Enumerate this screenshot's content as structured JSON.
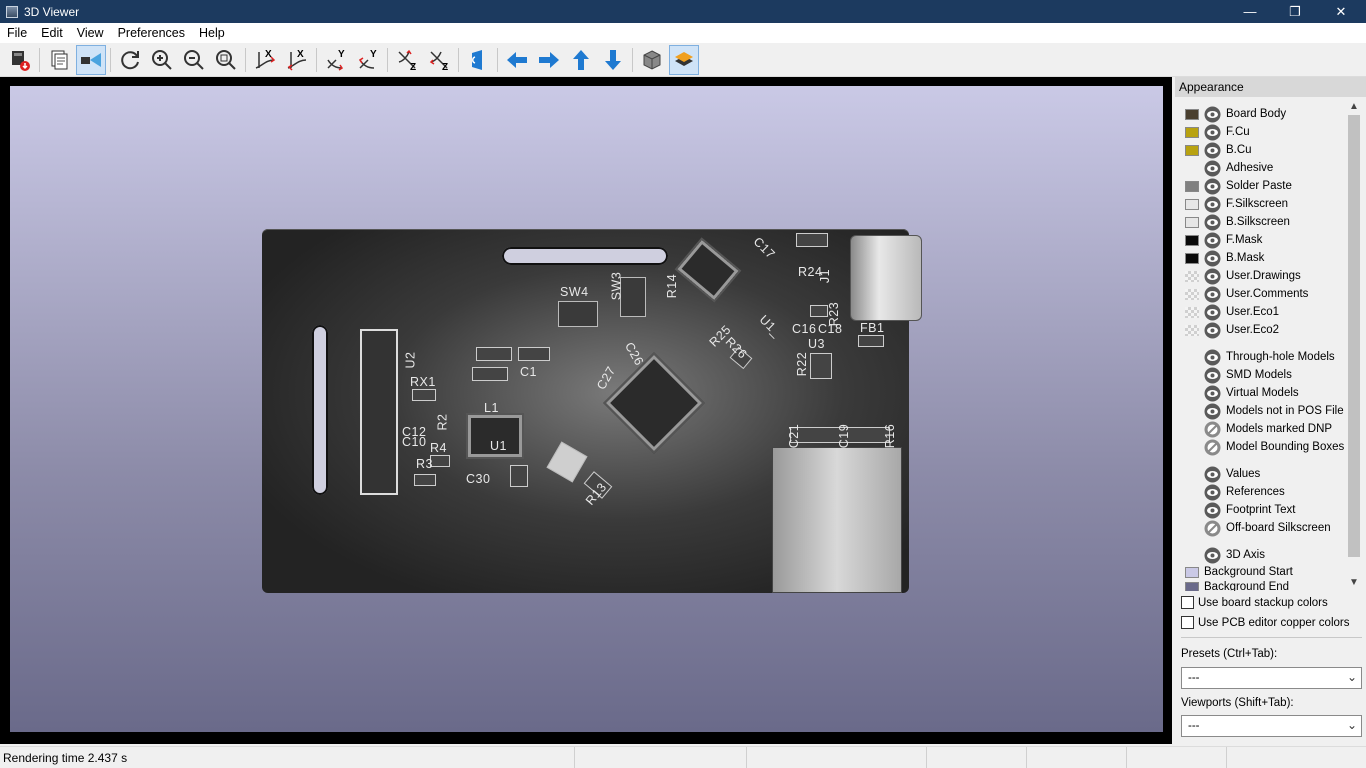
{
  "window": {
    "title": "3D Viewer",
    "minimize_glyph": "—",
    "maximize_glyph": "❐",
    "close_glyph": "✕"
  },
  "menu": [
    "File",
    "Edit",
    "View",
    "Preferences",
    "Help"
  ],
  "toolbar": {
    "buttons": [
      {
        "name": "export-image-icon"
      },
      {
        "name": "copy-to-clipboard-icon"
      },
      {
        "name": "raytracing-icon",
        "active": true
      },
      {
        "name": "refresh-icon"
      },
      {
        "name": "zoom-in-icon"
      },
      {
        "name": "zoom-out-icon"
      },
      {
        "name": "zoom-fit-icon"
      },
      {
        "name": "rotate-x-cw-icon"
      },
      {
        "name": "rotate-x-ccw-icon"
      },
      {
        "name": "rotate-y-cw-icon"
      },
      {
        "name": "rotate-y-ccw-icon"
      },
      {
        "name": "rotate-z-cw-icon"
      },
      {
        "name": "rotate-z-ccw-icon"
      },
      {
        "name": "flip-board-icon"
      },
      {
        "name": "move-left-icon"
      },
      {
        "name": "move-right-icon"
      },
      {
        "name": "move-up-icon"
      },
      {
        "name": "move-down-icon"
      },
      {
        "name": "toggle-orthographic-icon"
      },
      {
        "name": "toggle-layers-icon",
        "active": true
      }
    ],
    "axis_x": "X",
    "axis_y": "Y",
    "axis_z": "Z"
  },
  "viewport": {
    "references": [
      "SW4",
      "SW3",
      "R14",
      "C17",
      "R24",
      "J1",
      "U2",
      "RX1",
      "C1",
      "L1",
      "R2",
      "C12",
      "C10",
      "R4",
      "R3",
      "U1",
      "C30",
      "R13",
      "C27",
      "C26",
      "R25",
      "R26",
      "U1_",
      "C16",
      "C18",
      "U3",
      "R23",
      "FB1",
      "R22",
      "R16",
      "C21",
      "C19"
    ]
  },
  "appearance": {
    "header": "Appearance",
    "layers": [
      {
        "name": "Board Body",
        "color": "#4a3f2f",
        "visible": true
      },
      {
        "name": "F.Cu",
        "color": "#b8a210",
        "visible": true
      },
      {
        "name": "B.Cu",
        "color": "#b8a210",
        "visible": true
      },
      {
        "name": "Adhesive",
        "color": "",
        "visible": true
      },
      {
        "name": "Solder Paste",
        "color": "#808080",
        "visible": true
      },
      {
        "name": "F.Silkscreen",
        "color": "#e6e6e6",
        "visible": true
      },
      {
        "name": "B.Silkscreen",
        "color": "#e6e6e6",
        "visible": true
      },
      {
        "name": "F.Mask",
        "color": "#0a0a0a",
        "visible": true
      },
      {
        "name": "B.Mask",
        "color": "#0a0a0a",
        "visible": true
      },
      {
        "name": "User.Drawings",
        "color": "checker",
        "visible": true
      },
      {
        "name": "User.Comments",
        "color": "checker",
        "visible": true
      },
      {
        "name": "User.Eco1",
        "color": "checker",
        "visible": true
      },
      {
        "name": "User.Eco2",
        "color": "checker",
        "visible": true
      }
    ],
    "models": [
      {
        "name": "Through-hole Models",
        "visible": true
      },
      {
        "name": "SMD Models",
        "visible": true
      },
      {
        "name": "Virtual Models",
        "visible": true
      },
      {
        "name": "Models not in POS File",
        "visible": true
      },
      {
        "name": "Models marked DNP",
        "visible": false
      },
      {
        "name": "Model Bounding Boxes",
        "visible": false
      }
    ],
    "text": [
      {
        "name": "Values",
        "visible": true
      },
      {
        "name": "References",
        "visible": true
      },
      {
        "name": "Footprint Text",
        "visible": true
      },
      {
        "name": "Off-board Silkscreen",
        "visible": false
      }
    ],
    "misc": [
      {
        "name": "3D Axis",
        "visible": true
      },
      {
        "name": "Background Start",
        "color": "#cac9e6"
      },
      {
        "name": "Background End",
        "color": "#6a6a8a"
      }
    ],
    "use_board_stackup": "Use board stackup colors",
    "use_pcb_copper": "Use PCB editor copper colors",
    "presets_label": "Presets (Ctrl+Tab):",
    "presets_value": "---",
    "viewports_label": "Viewports (Shift+Tab):",
    "viewports_value": "---"
  },
  "status": {
    "text": "Rendering time 2.437 s"
  }
}
